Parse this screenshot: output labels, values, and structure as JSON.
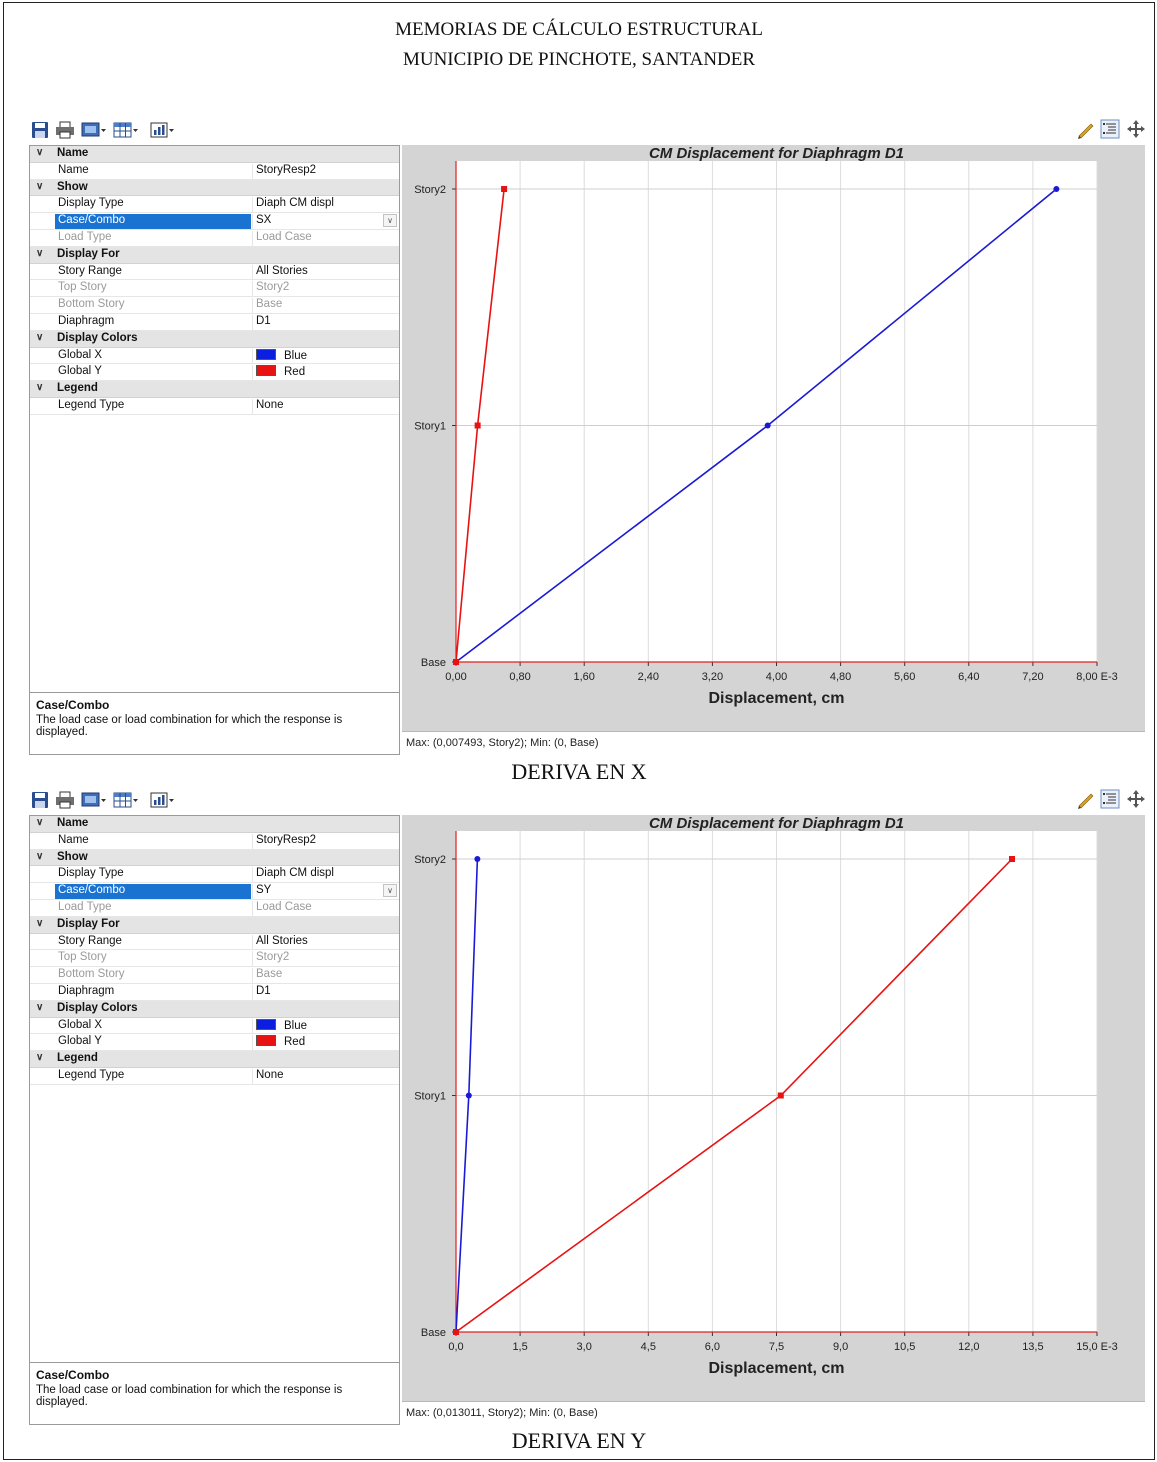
{
  "header": {
    "line1": "MEMORIAS DE CÁLCULO ESTRUCTURAL",
    "line2": "MUNICIPIO DE PINCHOTE, SANTANDER"
  },
  "icons": {
    "toolbar_left": [
      "save-icon",
      "print-icon",
      "display-options-icon",
      "table-icon",
      "chart-icon"
    ],
    "toolbar_right": [
      "pencil-icon",
      "property-list-icon",
      "move-icon"
    ]
  },
  "panels": [
    {
      "caption": "DERIVA EN X",
      "properties": [
        {
          "type": "category",
          "label": "Name"
        },
        {
          "type": "row",
          "key": "Name",
          "value": "StoryResp2"
        },
        {
          "type": "category",
          "label": "Show"
        },
        {
          "type": "row",
          "key": "Display Type",
          "value": "Diaph CM displ"
        },
        {
          "type": "row",
          "key": "Case/Combo",
          "value": "SX",
          "selected": true,
          "dropdown": true
        },
        {
          "type": "row",
          "key": "Load Type",
          "value": "Load Case",
          "disabled": true
        },
        {
          "type": "category",
          "label": "Display For"
        },
        {
          "type": "row",
          "key": "Story Range",
          "value": "All Stories"
        },
        {
          "type": "row",
          "key": "Top Story",
          "value": "Story2",
          "disabled": true
        },
        {
          "type": "row",
          "key": "Bottom Story",
          "value": "Base",
          "disabled": true
        },
        {
          "type": "row",
          "key": "Diaphragm",
          "value": "D1"
        },
        {
          "type": "category",
          "label": "Display Colors"
        },
        {
          "type": "row",
          "key": "Global X",
          "value": "Blue",
          "swatch": "#0a1fe0"
        },
        {
          "type": "row",
          "key": "Global Y",
          "value": "Red",
          "swatch": "#e81212"
        },
        {
          "type": "category",
          "label": "Legend"
        },
        {
          "type": "row",
          "key": "Legend Type",
          "value": "None"
        }
      ],
      "description": {
        "title": "Case/Combo",
        "text": "The load case or load combination for which the response is displayed."
      },
      "status": "Max: (0,007493, Story2);   Min: (0, Base)",
      "chart_data": {
        "type": "line",
        "title": "CM Displacement for Diaphragm D1",
        "xlabel": "Displacement, cm",
        "x_ticks": [
          "0,00",
          "0,80",
          "1,60",
          "2,40",
          "3,20",
          "4,00",
          "4,80",
          "5,60",
          "6,40",
          "7,20",
          "8,00 E-3"
        ],
        "xlim": [
          0,
          8.0
        ],
        "x_multiplier": "E-3",
        "categories": [
          "Base",
          "Story1",
          "Story2"
        ],
        "grid": true,
        "series": [
          {
            "name": "Global X",
            "color": "#1a1ad6",
            "marker": "circle",
            "values": [
              0,
              3.89,
              7.493
            ]
          },
          {
            "name": "Global Y",
            "color": "#e81212",
            "marker": "square",
            "values": [
              0,
              0.27,
              0.6
            ]
          }
        ]
      }
    },
    {
      "caption": "DERIVA EN Y",
      "properties": [
        {
          "type": "category",
          "label": "Name"
        },
        {
          "type": "row",
          "key": "Name",
          "value": "StoryResp2"
        },
        {
          "type": "category",
          "label": "Show"
        },
        {
          "type": "row",
          "key": "Display Type",
          "value": "Diaph CM displ"
        },
        {
          "type": "row",
          "key": "Case/Combo",
          "value": "SY",
          "selected": true,
          "dropdown": true
        },
        {
          "type": "row",
          "key": "Load Type",
          "value": "Load Case",
          "disabled": true
        },
        {
          "type": "category",
          "label": "Display For"
        },
        {
          "type": "row",
          "key": "Story Range",
          "value": "All Stories"
        },
        {
          "type": "row",
          "key": "Top Story",
          "value": "Story2",
          "disabled": true
        },
        {
          "type": "row",
          "key": "Bottom Story",
          "value": "Base",
          "disabled": true
        },
        {
          "type": "row",
          "key": "Diaphragm",
          "value": "D1"
        },
        {
          "type": "category",
          "label": "Display Colors"
        },
        {
          "type": "row",
          "key": "Global X",
          "value": "Blue",
          "swatch": "#0a1fe0"
        },
        {
          "type": "row",
          "key": "Global Y",
          "value": "Red",
          "swatch": "#e81212"
        },
        {
          "type": "category",
          "label": "Legend"
        },
        {
          "type": "row",
          "key": "Legend Type",
          "value": "None"
        }
      ],
      "description": {
        "title": "Case/Combo",
        "text": "The load case or load combination for which the response is displayed."
      },
      "status": "Max: (0,013011, Story2);   Min: (0, Base)",
      "chart_data": {
        "type": "line",
        "title": "CM Displacement for Diaphragm D1",
        "xlabel": "Displacement, cm",
        "x_ticks": [
          "0,0",
          "1,5",
          "3,0",
          "4,5",
          "6,0",
          "7,5",
          "9,0",
          "10,5",
          "12,0",
          "13,5",
          "15,0 E-3"
        ],
        "xlim": [
          0,
          15.0
        ],
        "x_multiplier": "E-3",
        "categories": [
          "Base",
          "Story1",
          "Story2"
        ],
        "grid": true,
        "series": [
          {
            "name": "Global X",
            "color": "#1a1ad6",
            "marker": "circle",
            "values": [
              0,
              0.3,
              0.5
            ]
          },
          {
            "name": "Global Y",
            "color": "#e81212",
            "marker": "square",
            "values": [
              0,
              7.6,
              13.011
            ]
          }
        ]
      }
    }
  ]
}
